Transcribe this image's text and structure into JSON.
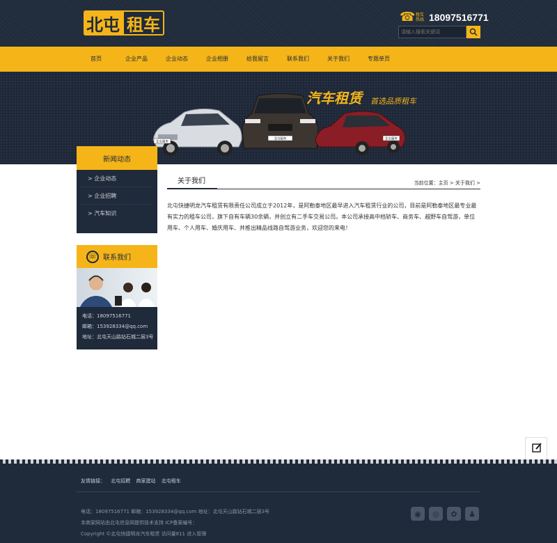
{
  "header": {
    "logo_part1": "北屯",
    "logo_part2": "租车",
    "hotline_label": "租车热线",
    "hotline_number": "18097516771",
    "search_placeholder": "请输入搜索关键词"
  },
  "nav": {
    "items": [
      "首页",
      "企业产品",
      "企业动态",
      "企业相册",
      "给我留言",
      "联系我们",
      "关于我们",
      "专题单页"
    ]
  },
  "banner": {
    "title": "汽车租赁",
    "subtitle": "首选品质租车",
    "car_plate_1": "北屯租车",
    "car_plate_2": "北屯租车",
    "car_plate_3": "北屯租车"
  },
  "sidebar": {
    "news_title": "新闻动态",
    "news_items": [
      "> 企业动态",
      "> 企业招聘",
      "> 汽车知识"
    ],
    "contact_title": "联系我们",
    "contact_phone": "电话：18097516771",
    "contact_email": "邮箱：153928334@qq.com",
    "contact_address": "地址：北屯天山路钻石城二层3号"
  },
  "main": {
    "section_title": "关于我们",
    "breadcrumb": "当前位置：主页 > 关于我们 >",
    "about_text": "北屯快捷明龙汽车租赁有限责任公司成立于2012年，是阿勒泰地区最早进入汽车租赁行业的公司，目前是阿勒泰地区最专业最有实力的租车公司，旗下自有车辆30余辆，并创立有二手车交易公司。本公司承接高中档轿车、商务车、越野车自驾游，单位用车、个人用车、婚庆用车、并推出精品线路自驾游业务，欢迎您的来电！"
  },
  "footer": {
    "friend_links_label": "友情链接：",
    "friend_links": [
      "北屯招聘",
      "商家建站",
      "北屯租车"
    ],
    "contact_line": "电话：18097516771 邮箱：153928334@qq.com     地址：北屯天山路钻石城二层3号",
    "support_line": "本商家网站由北屯信息网提供技术支持    ICP备案编号：",
    "copyright_line": "Copyright ©北屯快捷明龙汽车租赁  访问量811 进入管理"
  },
  "colors": {
    "brand_yellow": "#f5b518",
    "dark_navy": "#1f2a3a"
  }
}
